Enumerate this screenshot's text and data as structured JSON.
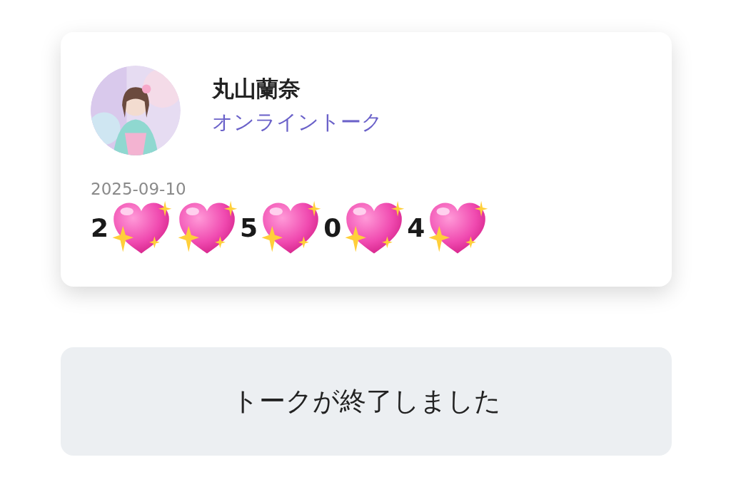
{
  "card": {
    "name": "丸山蘭奈",
    "subtitle": "オンライントーク",
    "date": "2025-09-10",
    "message": [
      {
        "kind": "text",
        "text": "2"
      },
      {
        "kind": "sticker"
      },
      {
        "kind": "sticker"
      },
      {
        "kind": "text",
        "text": "5"
      },
      {
        "kind": "sticker"
      },
      {
        "kind": "text",
        "text": "0"
      },
      {
        "kind": "sticker"
      },
      {
        "kind": "text",
        "text": "4"
      },
      {
        "kind": "sticker"
      }
    ]
  },
  "status_button": {
    "label": "トークが終了しました"
  }
}
